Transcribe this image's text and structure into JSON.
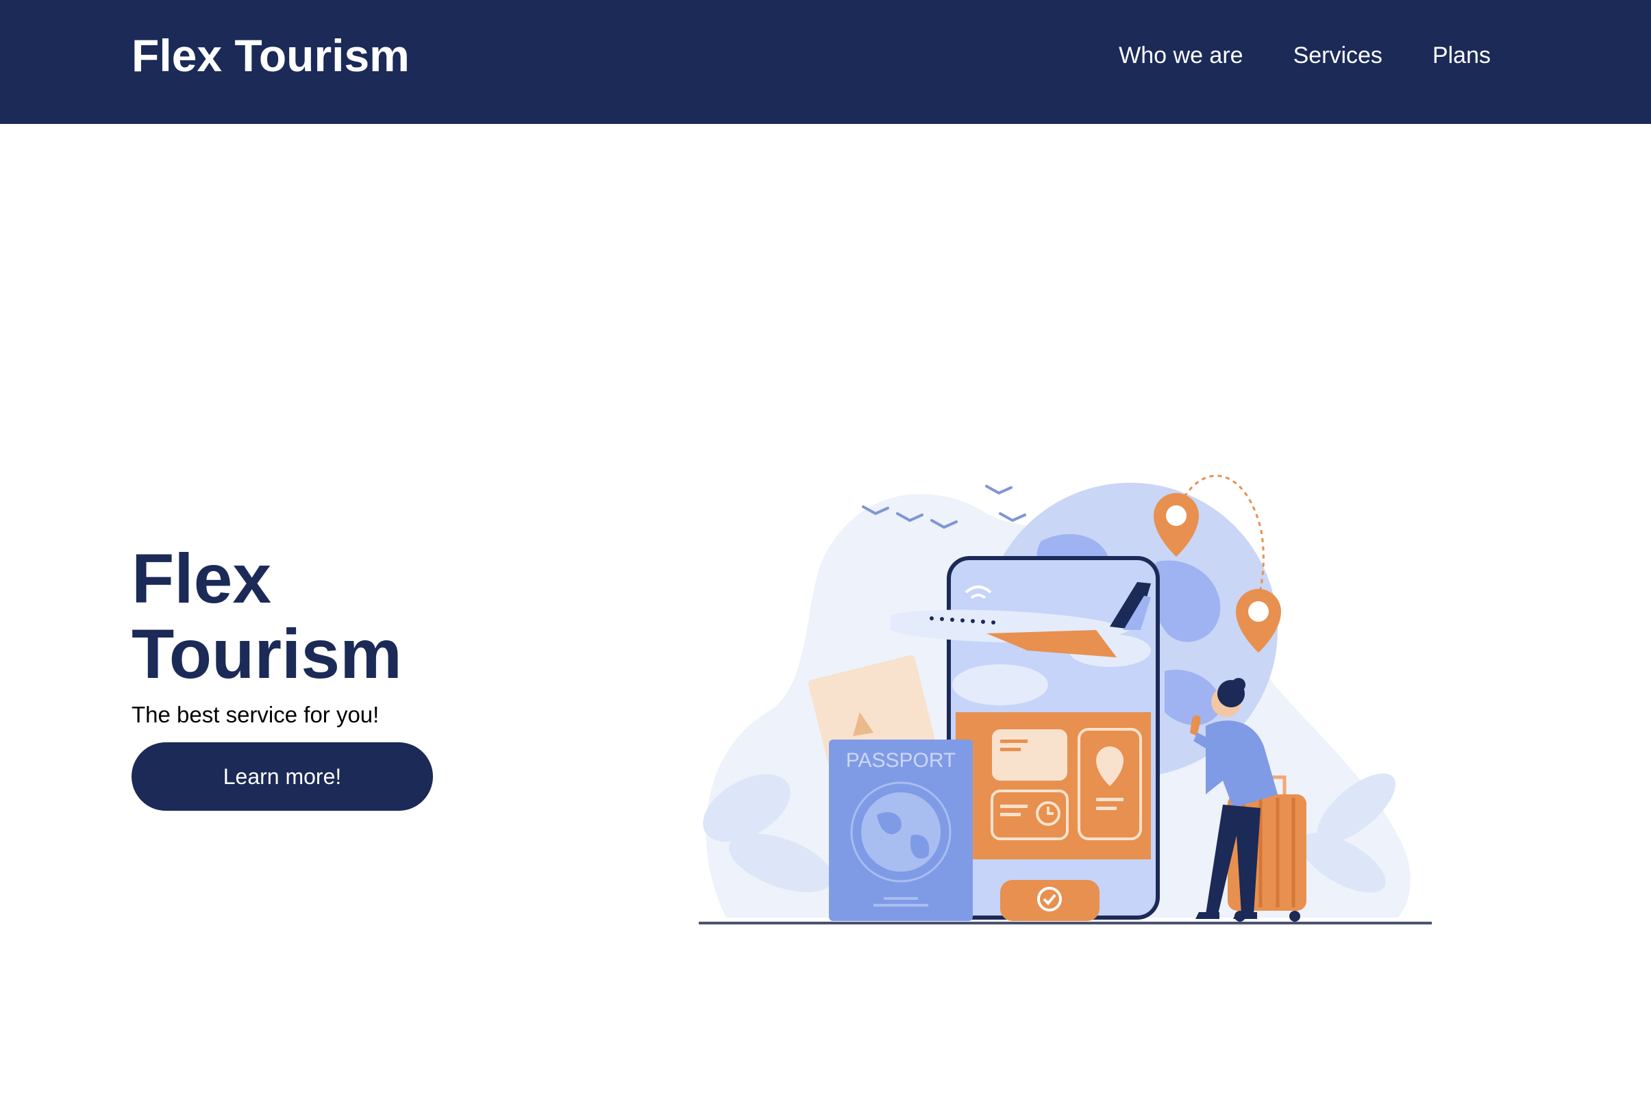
{
  "header": {
    "brand": "Flex Tourism",
    "nav": [
      {
        "label": "Who we are"
      },
      {
        "label": "Services"
      },
      {
        "label": "Plans"
      }
    ]
  },
  "hero": {
    "title_line1": "Flex",
    "title_line2": "Tourism",
    "subtitle": "The best service for you!",
    "cta_label": "Learn more!"
  },
  "illustration": {
    "passport_text": "PASSPORT"
  },
  "colors": {
    "navy": "#1b2a57",
    "orange": "#e8904f",
    "light_blue": "#9fb3f2",
    "pale_blue": "#edf2fb"
  },
  "icons": [
    "airplane-icon",
    "location-pin-icon",
    "wifi-icon",
    "checkmark-icon",
    "clock-icon"
  ]
}
